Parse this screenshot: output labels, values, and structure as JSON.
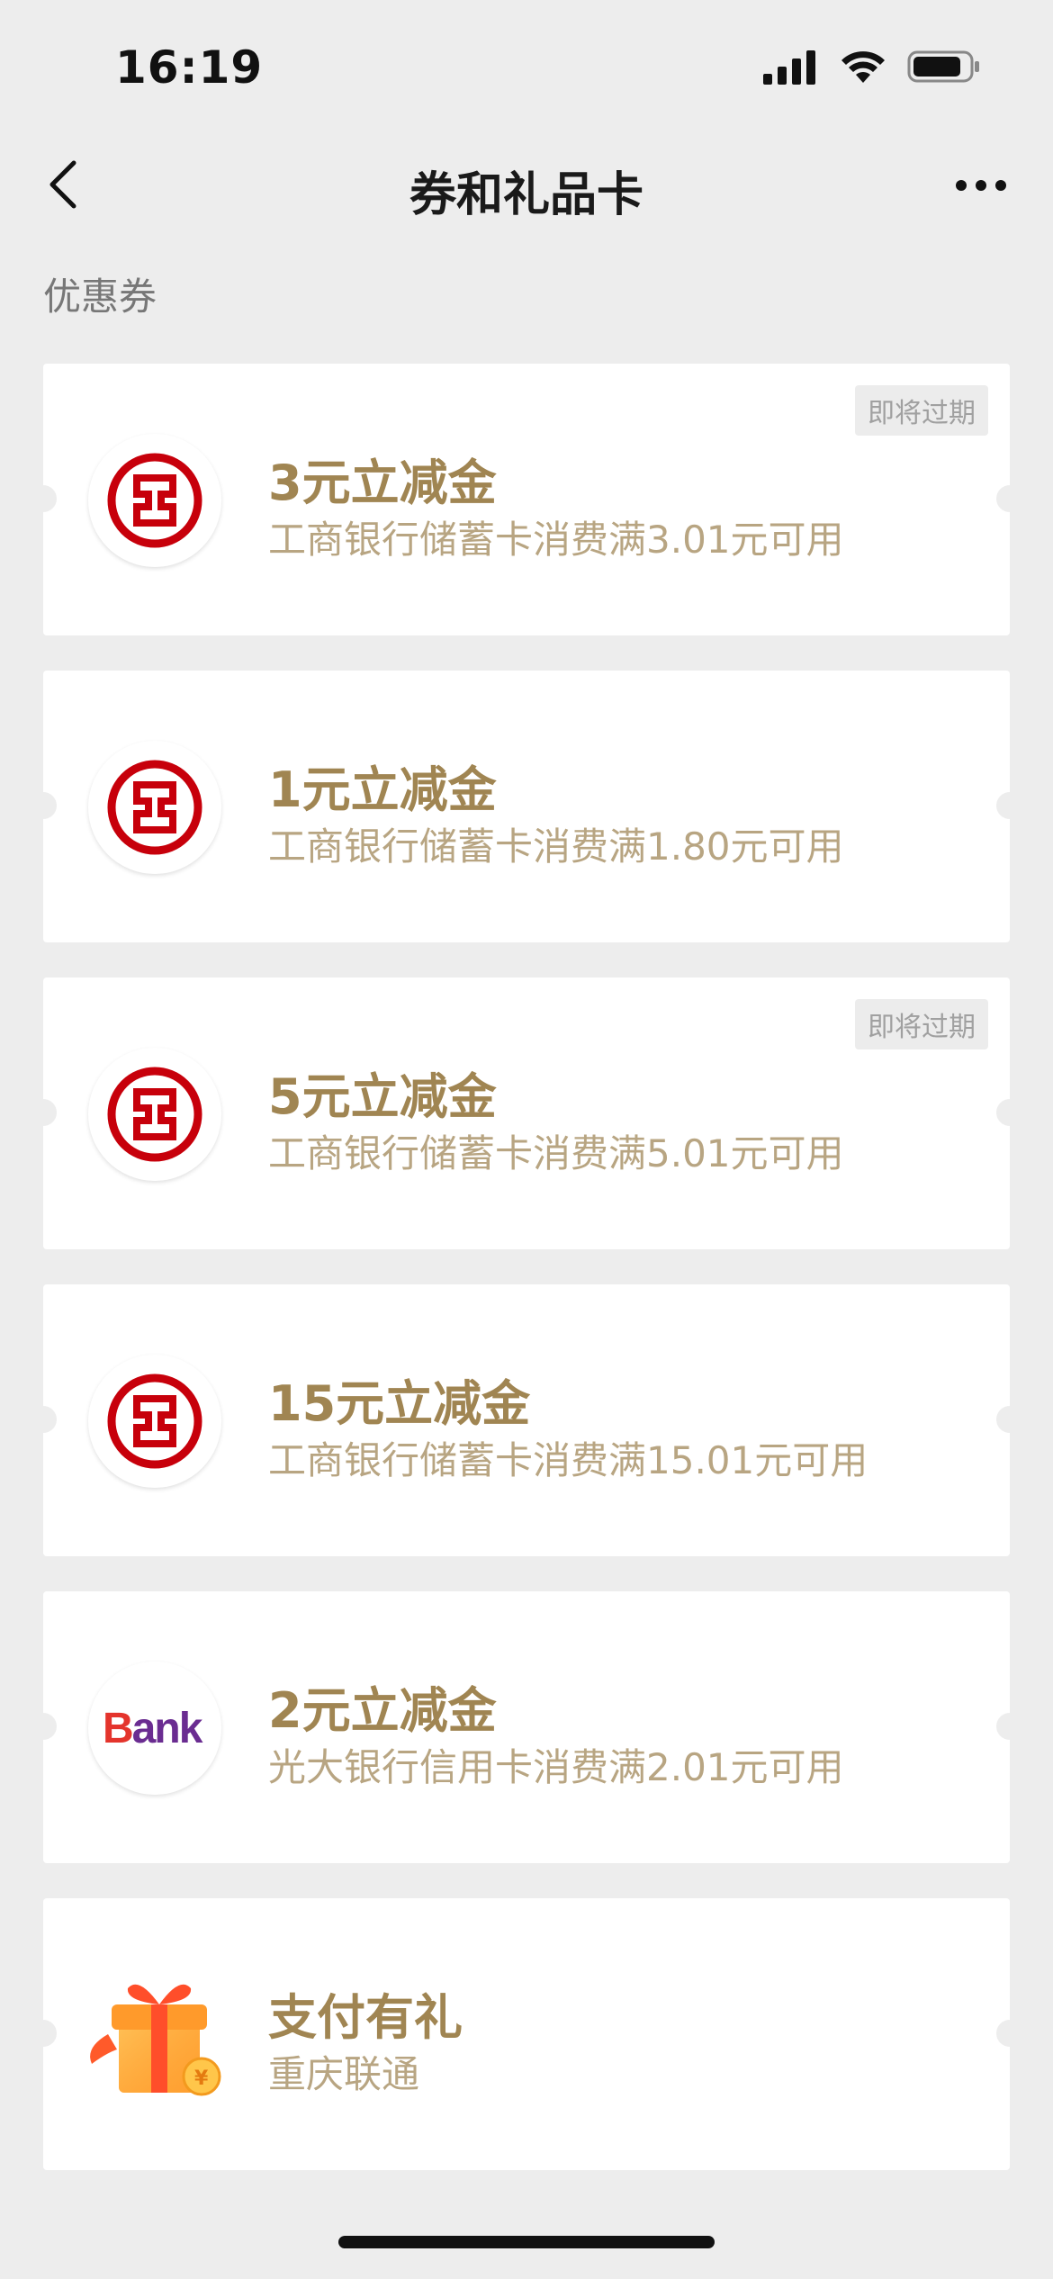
{
  "status_bar": {
    "time": "16:19"
  },
  "nav": {
    "title": "券和礼品卡"
  },
  "section": {
    "title": "优惠券"
  },
  "colors": {
    "background": "#ededed",
    "card_title": "#a08552",
    "card_desc": "#b8a582",
    "icbc_red": "#c7000b"
  },
  "coupons": [
    {
      "title": "3元立减金",
      "desc": "工商银行储蓄卡消费满3.01元可用",
      "tag": "即将过期",
      "logo": "icbc-logo-icon"
    },
    {
      "title": "1元立减金",
      "desc": "工商银行储蓄卡消费满1.80元可用",
      "tag": "",
      "logo": "icbc-logo-icon"
    },
    {
      "title": "5元立减金",
      "desc": "工商银行储蓄卡消费满5.01元可用",
      "tag": "即将过期",
      "logo": "icbc-logo-icon"
    },
    {
      "title": "15元立减金",
      "desc": "工商银行储蓄卡消费满15.01元可用",
      "tag": "",
      "logo": "icbc-logo-icon"
    },
    {
      "title": "2元立减金",
      "desc": "光大银行信用卡消费满2.01元可用",
      "tag": "",
      "logo": "bank-logo-icon",
      "logo_text": "Bank"
    },
    {
      "title": "支付有礼",
      "desc": "重庆联通",
      "tag": "",
      "logo": "gift-box-icon"
    }
  ]
}
